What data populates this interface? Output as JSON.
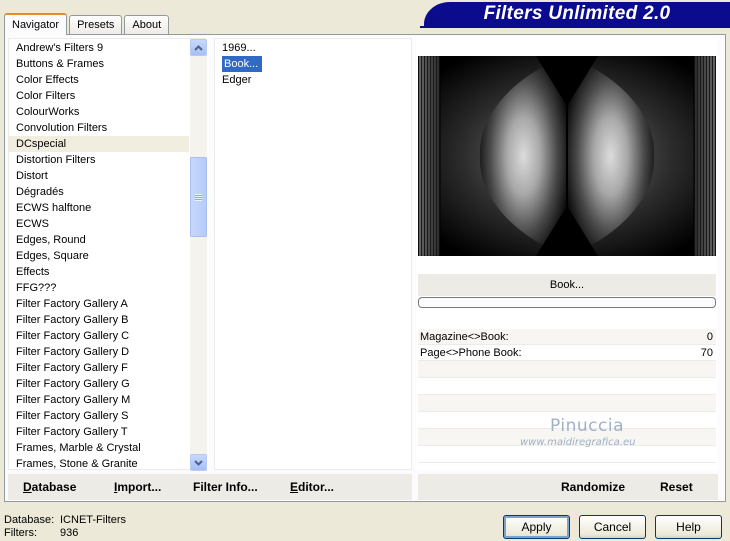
{
  "banner": {
    "title": "Filters Unlimited 2.0"
  },
  "tabs": [
    {
      "label": "Navigator",
      "active": true
    },
    {
      "label": "Presets",
      "active": false
    },
    {
      "label": "About",
      "active": false
    }
  ],
  "categories": {
    "items": [
      "Andrew's Filters 9",
      "Buttons & Frames",
      "Color Effects",
      "Color Filters",
      "ColourWorks",
      "Convolution Filters",
      "DCspecial",
      "Distortion Filters",
      "Distort",
      "Dégradés",
      "ECWS halftone",
      "ECWS",
      "Edges, Round",
      "Edges, Square",
      "Effects",
      "FFG???",
      "Filter Factory Gallery A",
      "Filter Factory Gallery B",
      "Filter Factory Gallery C",
      "Filter Factory Gallery D",
      "Filter Factory Gallery F",
      "Filter Factory Gallery G",
      "Filter Factory Gallery M",
      "Filter Factory Gallery S",
      "Filter Factory Gallery T",
      "Frames, Marble & Crystal",
      "Frames, Stone & Granite"
    ],
    "selected": "DCspecial"
  },
  "filters": {
    "items": [
      "1969...",
      "Book...",
      "Edger"
    ],
    "selected": "Book..."
  },
  "preview": {
    "filter_name": "Book...",
    "progress": 0
  },
  "params": [
    {
      "label": "Magazine<>Book:",
      "value": "0"
    },
    {
      "label": "Page<>Phone Book:",
      "value": "70"
    }
  ],
  "watermark": {
    "name": "Pinuccia",
    "url": "www.maidiregrafica.eu"
  },
  "toolbar": {
    "database": "Database",
    "import": "Import...",
    "filter_info": "Filter Info...",
    "editor": "Editor...",
    "randomize": "Randomize",
    "reset": "Reset"
  },
  "footer": {
    "database_label": "Database:",
    "database_value": "ICNET-Filters",
    "filters_label": "Filters:",
    "filters_value": "936"
  },
  "buttons": {
    "apply": "Apply",
    "cancel": "Cancel",
    "help": "Help"
  },
  "colors": {
    "banner": "#0b0b8e",
    "selection": "#316ac5",
    "accent": "#e68b2c"
  }
}
